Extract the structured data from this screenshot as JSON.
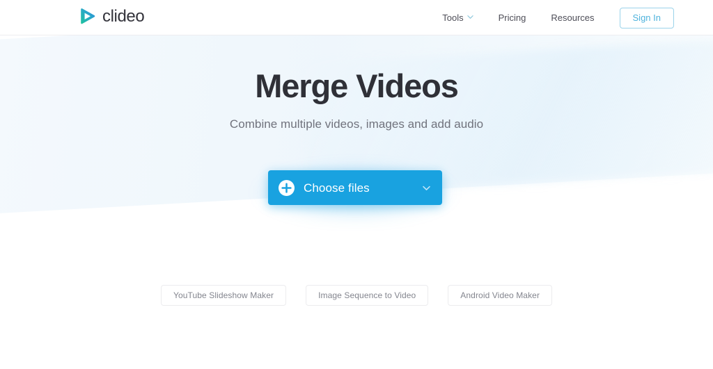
{
  "header": {
    "logo": {
      "text": "clideo",
      "icon": "play-logo-icon",
      "gradient_from": "#22c39a",
      "gradient_to": "#2b8fe0"
    },
    "nav": [
      {
        "label": "Tools",
        "has_dropdown": true,
        "icon": "chevron-down-icon"
      },
      {
        "label": "Pricing",
        "has_dropdown": false
      },
      {
        "label": "Resources",
        "has_dropdown": false
      }
    ],
    "signin_label": "Sign In",
    "signin_border_color": "#9bd3ea",
    "signin_text_color": "#4fb3dd"
  },
  "hero": {
    "title": "Merge Videos",
    "subtitle": "Combine multiple videos, images and add audio",
    "title_color": "#2f3037",
    "subtitle_color": "#70727c"
  },
  "cta": {
    "label": "Choose files",
    "plus_icon": "plus-circle-icon",
    "dropdown_icon": "chevron-down-icon",
    "background_color": "#19a2e0",
    "text_color": "#ffffff"
  },
  "related_tools": [
    {
      "label": "YouTube Slideshow Maker"
    },
    {
      "label": "Image Sequence to Video"
    },
    {
      "label": "Android Video Maker"
    }
  ]
}
